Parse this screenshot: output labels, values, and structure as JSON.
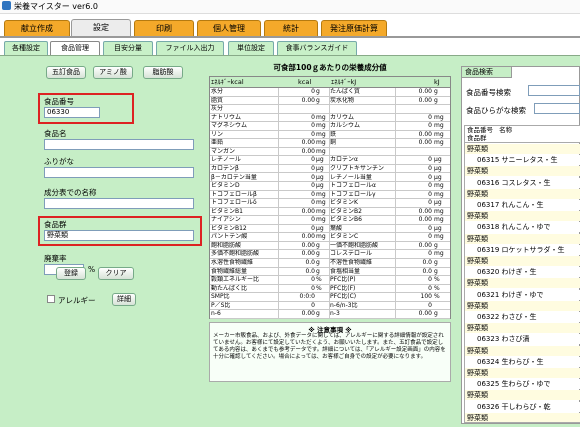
{
  "app": {
    "title": "栄養マイスター ver6.0"
  },
  "main_tabs": [
    "献立作成",
    "設定",
    "印刷",
    "個人管理",
    "統計",
    "発注原価計算"
  ],
  "sub_tabs": [
    "各種設定",
    "食品管理",
    "目安分量",
    "ファイル入出力",
    "単位設定",
    "食事バランスガイド"
  ],
  "left": {
    "buttons": [
      "五訂食品",
      "アミノ酸",
      "脂肪酸"
    ],
    "food_number_label": "食品番号",
    "food_number_value": "06330",
    "food_name_label": "食品名",
    "furigana_label": "ふりがな",
    "table_name_label": "成分表での名称",
    "food_group_label": "食品群",
    "food_group_value": "野菜類",
    "waste_label": "廃棄率",
    "waste_unit": "%",
    "register_label": "登録",
    "clear_label": "クリア",
    "allergy_label": "アレルギー",
    "detail_label": "詳細"
  },
  "grid": {
    "title": "可食部100ｇあたりの栄養成分値",
    "header_left": "ｴﾈﾙｷﾞｰkcal",
    "header_left_unit": "kcal",
    "header_right": "ｴﾈﾙｷﾞｰkJ",
    "header_right_unit": "kJ",
    "rows": [
      {
        "n1": "水分",
        "v1": "0",
        "u1": "g",
        "n2": "たんぱく質",
        "v2": "0.00",
        "u2": "g"
      },
      {
        "n1": "脂質",
        "v1": "0.00",
        "u1": "g",
        "n2": "炭水化物",
        "v2": "0.00",
        "u2": "g"
      },
      {
        "n1": "灰分",
        "v1": "",
        "u1": "",
        "n2": "",
        "v2": "",
        "u2": ""
      },
      {
        "n1": "ナトリウム",
        "v1": "0",
        "u1": "mg",
        "n2": "カリウム",
        "v2": "0",
        "u2": "mg"
      },
      {
        "n1": "マグネシウム",
        "v1": "0",
        "u1": "mg",
        "n2": "カルシウム",
        "v2": "0",
        "u2": "mg"
      },
      {
        "n1": "リン",
        "v1": "0",
        "u1": "mg",
        "n2": "鉄",
        "v2": "0.00",
        "u2": "mg"
      },
      {
        "n1": "亜鉛",
        "v1": "0.00",
        "u1": "mg",
        "n2": "銅",
        "v2": "0.00",
        "u2": "mg"
      },
      {
        "n1": "マンガン",
        "v1": "0.00",
        "u1": "mg",
        "n2": "",
        "v2": "",
        "u2": ""
      },
      {
        "n1": "レチノール",
        "v1": "0",
        "u1": "μg",
        "n2": "カロテンα",
        "v2": "0",
        "u2": "μg"
      },
      {
        "n1": "カロテンβ",
        "v1": "0",
        "u1": "μg",
        "n2": "クリプトキサンチン",
        "v2": "0",
        "u2": "μg"
      },
      {
        "n1": "β－カロテン当量",
        "v1": "0",
        "u1": "μg",
        "n2": "レチノール当量",
        "v2": "0",
        "u2": "μg"
      },
      {
        "n1": "ビタミンD",
        "v1": "0",
        "u1": "μg",
        "n2": "トコフェロールα",
        "v2": "0",
        "u2": "mg"
      },
      {
        "n1": "トコフェロールβ",
        "v1": "0",
        "u1": "mg",
        "n2": "トコフェロールγ",
        "v2": "0",
        "u2": "mg"
      },
      {
        "n1": "トコフェロールδ",
        "v1": "0",
        "u1": "mg",
        "n2": "ビタミンK",
        "v2": "0",
        "u2": "μg"
      },
      {
        "n1": "ビタミンB1",
        "v1": "0.00",
        "u1": "mg",
        "n2": "ビタミンB2",
        "v2": "0.00",
        "u2": "mg"
      },
      {
        "n1": "ナイアシン",
        "v1": "0",
        "u1": "mg",
        "n2": "ビタミンB6",
        "v2": "0.00",
        "u2": "mg"
      },
      {
        "n1": "ビタミンB12",
        "v1": "0",
        "u1": "μg",
        "n2": "葉酸",
        "v2": "0",
        "u2": "μg"
      },
      {
        "n1": "パントテン酸",
        "v1": "0.00",
        "u1": "mg",
        "n2": "ビタミンC",
        "v2": "0",
        "u2": "mg"
      },
      {
        "n1": "飽和脂肪酸",
        "v1": "0.00",
        "u1": "g",
        "n2": "一価不飽和脂肪酸",
        "v2": "0.00",
        "u2": "g"
      },
      {
        "n1": "多価不飽和脂肪酸",
        "v1": "0.00",
        "u1": "g",
        "n2": "コレステロール",
        "v2": "0",
        "u2": "mg"
      },
      {
        "n1": "水溶性食物繊維",
        "v1": "0.0",
        "u1": "g",
        "n2": "不溶性食物繊維",
        "v2": "0.0",
        "u2": "g"
      },
      {
        "n1": "食物繊維総量",
        "v1": "0.0",
        "u1": "g",
        "n2": "食塩相当量",
        "v2": "0.0",
        "u2": "g"
      },
      {
        "n1": "穀類エネルギー比",
        "v1": "0",
        "u1": "%",
        "n2": "PFC比(P)",
        "v2": "0",
        "u2": "%"
      },
      {
        "n1": "動たんぱく比",
        "v1": "0",
        "u1": "%",
        "n2": "PFC比(F)",
        "v2": "0",
        "u2": "%"
      },
      {
        "n1": "SMP比",
        "v1": "0:0:0",
        "u1": "",
        "n2": "PFC比(C)",
        "v2": "100",
        "u2": "%"
      },
      {
        "n1": "P／S比",
        "v1": "0",
        "u1": "",
        "n2": "n-6/n-3比",
        "v2": "0",
        "u2": ""
      },
      {
        "n1": "n-6",
        "v1": "0.00",
        "u1": "g",
        "n2": "n-3",
        "v2": "0.00",
        "u2": "g"
      }
    ]
  },
  "notes": {
    "title": "※ 注意事項 ※",
    "body": "メーカー市販食品、および、外食データに関しては、アレルギーに関する詳細情報が設定されていません。お客様にて設定していただくよう、お願いいたします。また、五訂食品で設定してある内容は、あくまでも参考データです。詳細については、「アレルギー設定画面」の内容を十分に確認してください。場合によっては、お客様ご自身での設定が必要になります。"
  },
  "search": {
    "tab_label": "食品検索",
    "number_search_label": "食品番号検索",
    "kana_search_label": "食品ひらがな検索",
    "col_number": "食品番号",
    "col_name": "名称",
    "col_group": "食品群",
    "items": [
      {
        "text": "野菜類",
        "grp": true
      },
      {
        "text": "06315 サニーレタス・生",
        "grp": false
      },
      {
        "text": "野菜類",
        "grp": true
      },
      {
        "text": "06316 コスレタス・生",
        "grp": false
      },
      {
        "text": "野菜類",
        "grp": true
      },
      {
        "text": "06317 れんこん・生",
        "grp": false
      },
      {
        "text": "野菜類",
        "grp": true
      },
      {
        "text": "06318 れんこん・ゆで",
        "grp": false
      },
      {
        "text": "野菜類",
        "grp": true
      },
      {
        "text": "06319 ロケットサラダ・生",
        "grp": false
      },
      {
        "text": "野菜類",
        "grp": true
      },
      {
        "text": "06320 わけぎ・生",
        "grp": false
      },
      {
        "text": "野菜類",
        "grp": true
      },
      {
        "text": "06321 わけぎ・ゆで",
        "grp": false
      },
      {
        "text": "野菜類",
        "grp": true
      },
      {
        "text": "06322 わさび・生",
        "grp": false
      },
      {
        "text": "野菜類",
        "grp": true
      },
      {
        "text": "06323 わさび漬",
        "grp": false
      },
      {
        "text": "野菜類",
        "grp": true
      },
      {
        "text": "06324 生わらび・生",
        "grp": false
      },
      {
        "text": "野菜類",
        "grp": true
      },
      {
        "text": "06325 生わらび・ゆで",
        "grp": false
      },
      {
        "text": "野菜類",
        "grp": true
      },
      {
        "text": "06326 干しわらび・乾",
        "grp": false
      },
      {
        "text": "野菜類",
        "grp": true
      }
    ]
  }
}
